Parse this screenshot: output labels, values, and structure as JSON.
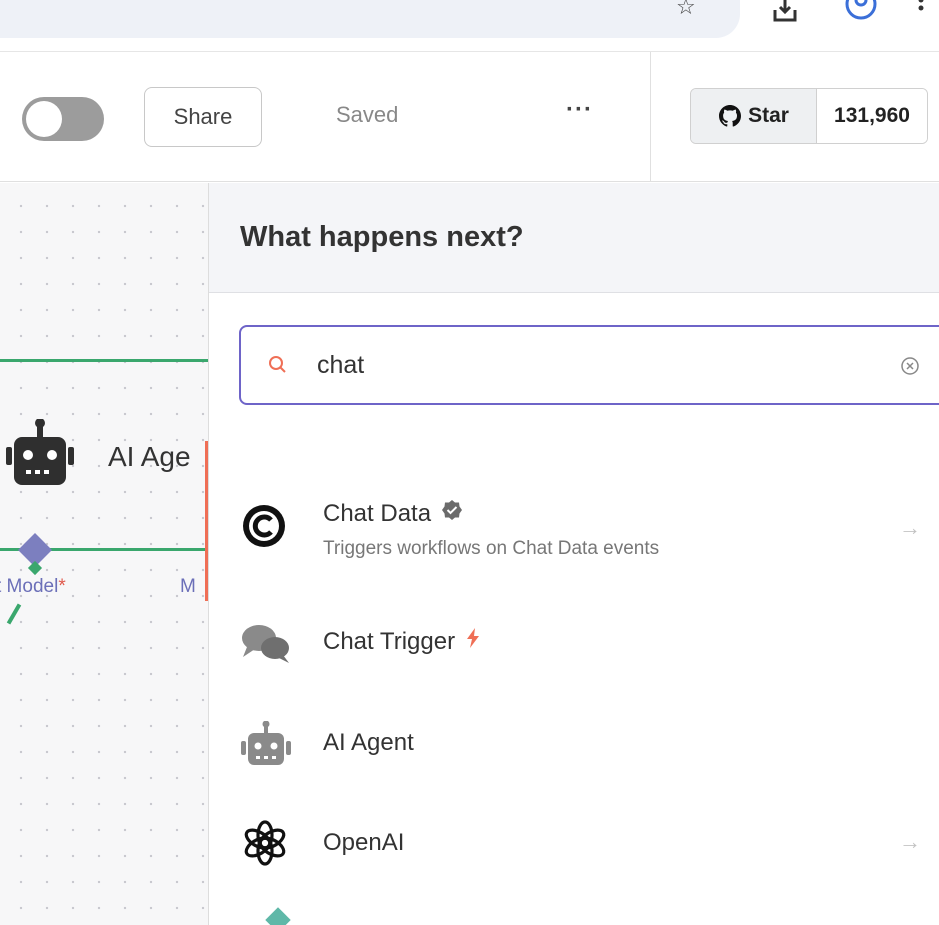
{
  "header": {
    "share_label": "Share",
    "status_label": "Saved",
    "more_label": "···",
    "github": {
      "star_label": "Star",
      "star_count": "131,960"
    }
  },
  "canvas": {
    "node_label": "AI Age",
    "chat_model_label": "t Model",
    "required_mark": "*",
    "memory_label": "M"
  },
  "panel": {
    "title": "What happens next?",
    "search": {
      "value": "chat"
    },
    "items": [
      {
        "title": "Chat Data",
        "description": "Triggers workflows on Chat Data events",
        "icon": "chat-data-logo-icon",
        "verified": true
      },
      {
        "title": "Chat Trigger",
        "icon": "chat-bubbles-icon",
        "trigger": true
      },
      {
        "title": "AI Agent",
        "icon": "robot-icon"
      },
      {
        "title": "OpenAI",
        "icon": "openai-logo-icon"
      }
    ]
  },
  "colors": {
    "accent": "#6e64c8",
    "edge_green": "#3aa76d",
    "edge_red": "#ef6f56",
    "trigger_bolt": "#ef6f56",
    "node_purple": "#7c7fbf"
  }
}
